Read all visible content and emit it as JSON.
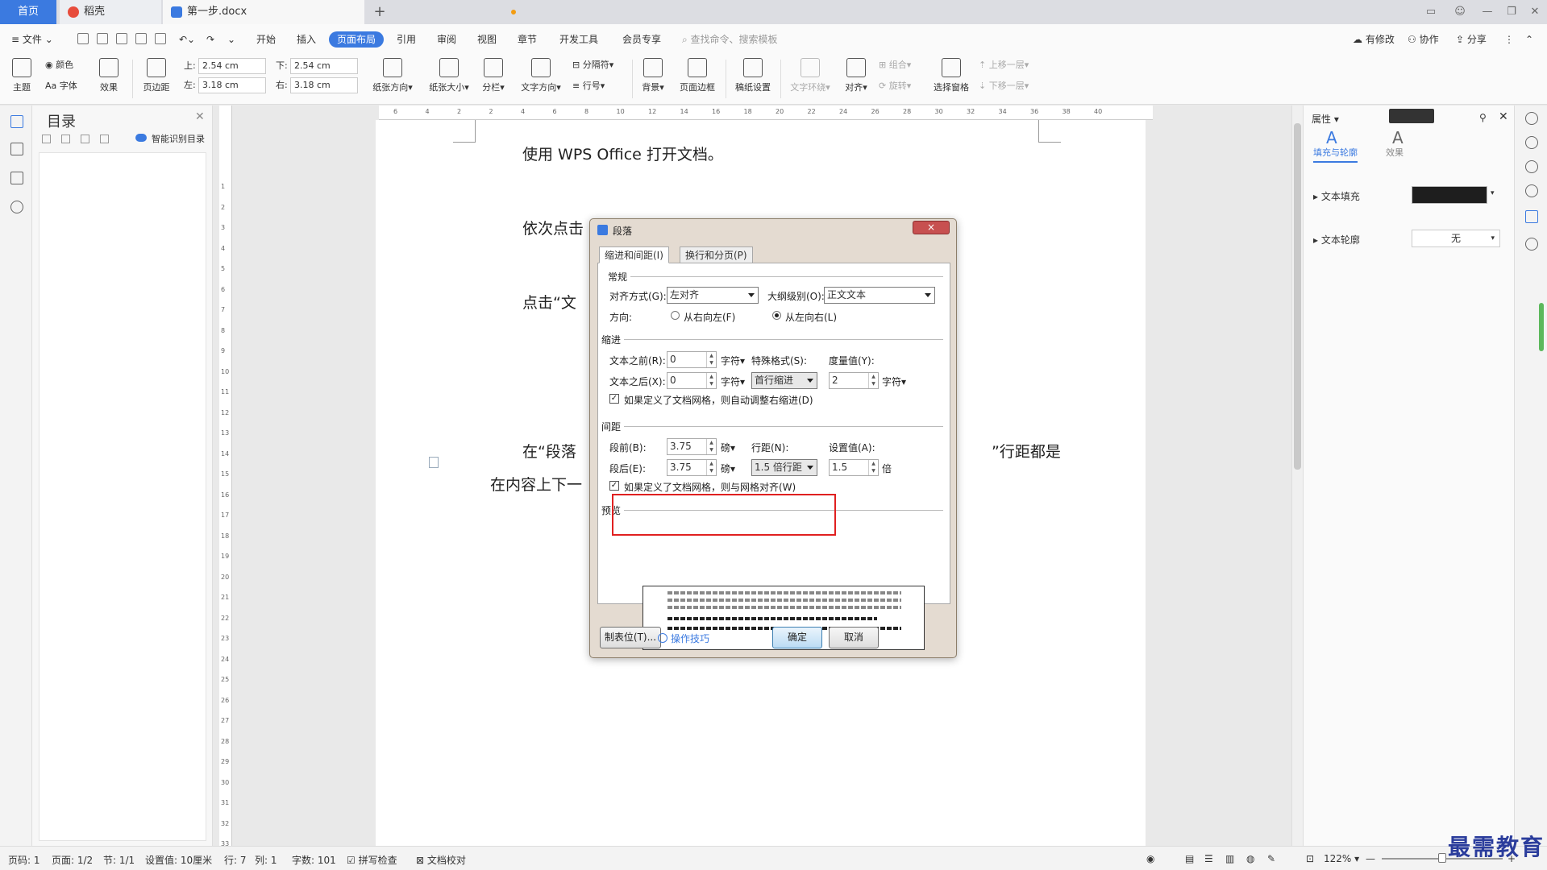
{
  "tabs": {
    "home": "首页",
    "docer": "稻壳",
    "doc": "第一步.docx",
    "add": "+"
  },
  "menu": {
    "file": "文件",
    "items": [
      "开始",
      "插入",
      "页面布局",
      "引用",
      "审阅",
      "视图",
      "章节",
      "开发工具",
      "会员专享"
    ],
    "search": "查找命令、搜索模板",
    "modified": "有修改",
    "collab": "协作",
    "share": "分享"
  },
  "ribbon": {
    "theme": "主题",
    "color": "颜色",
    "font": "字体",
    "effect": "效果",
    "margins": "页边距",
    "margin_top_label": "上:",
    "margin_top": "2.54 cm",
    "margin_bottom_label": "下:",
    "margin_bottom": "2.54 cm",
    "margin_left_label": "左:",
    "margin_left": "3.18 cm",
    "margin_right_label": "右:",
    "margin_right": "3.18 cm",
    "orientation": "纸张方向",
    "size": "纸张大小",
    "columns": "分栏",
    "text_direction": "文字方向",
    "breaks": "分隔符",
    "line_numbers": "行号",
    "background": "背景",
    "page_border": "页面边框",
    "manuscript": "稿纸设置",
    "text_wrap": "文字环绕",
    "align": "对齐",
    "group": "组合",
    "rotate": "旋转",
    "selection_pane": "选择窗格",
    "bring_forward": "上移一层",
    "send_backward": "下移一层"
  },
  "toc": {
    "title": "目录",
    "smart": "智能识别目录"
  },
  "hruler": [
    "6",
    "4",
    "2",
    "2",
    "4",
    "6",
    "8",
    "10",
    "12",
    "14",
    "16",
    "18",
    "20",
    "22",
    "24",
    "26",
    "28",
    "30",
    "32",
    "34",
    "36",
    "38",
    "40"
  ],
  "vruler": [
    "1",
    "2",
    "3",
    "4",
    "5",
    "6",
    "7",
    "8",
    "9",
    "10",
    "11",
    "12",
    "13",
    "14",
    "15",
    "16",
    "17",
    "18",
    "19",
    "20",
    "21",
    "22",
    "23",
    "24",
    "25",
    "26",
    "27",
    "28",
    "29",
    "30",
    "31",
    "32",
    "33"
  ],
  "doc": {
    "line1": "使用 WPS Office 打开文档。",
    "line2": "依次点击",
    "line3": "点击“文",
    "line4a": "在“段落",
    "line4b": "”行距都是",
    "line5": "在内容上下一"
  },
  "props": {
    "title": "属性",
    "tab_fill": "填充与轮廓",
    "tab_effect": "效果",
    "text_fill": "文本填充",
    "text_outline": "文本轮廓",
    "outline_value": "无",
    "fill_color": "#1e1e1e"
  },
  "dialog": {
    "title": "段落",
    "close": "×",
    "tab_indent": "缩进和间距(I)",
    "tab_page": "换行和分页(P)",
    "sec_general": "常规",
    "align_label": "对齐方式(G):",
    "align_value": "左对齐",
    "outline_label": "大纲级别(O):",
    "outline_value": "正文文本",
    "direction_label": "方向:",
    "rtl": "从右向左(F)",
    "ltr": "从左向右(L)",
    "sec_indent": "缩进",
    "before_text_label": "文本之前(R):",
    "before_text": "0",
    "after_text_label": "文本之后(X):",
    "after_text": "0",
    "unit_char": "字符▾",
    "special_label": "特殊格式(S):",
    "special_value": "首行缩进",
    "measure_label": "度量值(Y):",
    "measure_value": "2",
    "auto_indent_check": "如果定义了文档网格，则自动调整右缩进(D)",
    "sec_spacing": "间距",
    "before_label": "段前(B):",
    "before_value": "3.75",
    "after_label": "段后(E):",
    "after_value": "3.75",
    "unit_pt": "磅▾",
    "linespace_label": "行距(N):",
    "linespace_value": "1.5 倍行距",
    "setvalue_label": "设置值(A):",
    "setvalue_value": "1.5",
    "unit_times": "倍",
    "grid_check": "如果定义了文档网格，则与网格对齐(W)",
    "sec_preview": "预览",
    "tabs_btn": "制表位(T)...",
    "tips": "操作技巧",
    "ok": "确定",
    "cancel": "取消"
  },
  "status": {
    "page_num": "页码: 1",
    "pages": "页面: 1/2",
    "section": "节: 1/1",
    "setting": "设置值: 10厘米",
    "row": "行: 7",
    "col": "列: 1",
    "words": "字数: 101",
    "spell": "拼写检查",
    "proof": "文档校对",
    "zoom": "122%"
  },
  "watermark": "最需教育"
}
